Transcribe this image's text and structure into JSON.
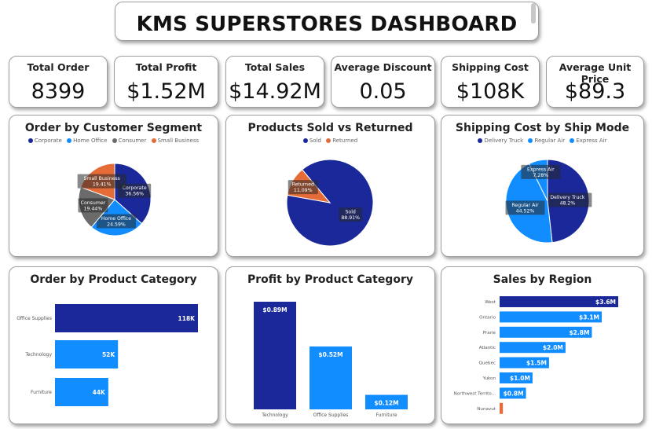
{
  "dashboard": {
    "title": "KMS SUPERSTORES DASHBOARD"
  },
  "kpis": [
    {
      "label": "Total Order",
      "value": "8399"
    },
    {
      "label": "Total Profit",
      "value": "$1.52M"
    },
    {
      "label": "Total Sales",
      "value": "$14.92M"
    },
    {
      "label": "Average Discount",
      "value": "0.05"
    },
    {
      "label": "Shipping Cost",
      "value": "$108K"
    },
    {
      "label": "Average Unit Price",
      "value": "$89.3"
    }
  ],
  "colors": {
    "dark_blue": "#1a2899",
    "light_blue": "#118dff",
    "orange": "#e66c37",
    "gray": "#6b6b6b"
  },
  "chart_data": [
    {
      "type": "pie",
      "title": "Order by Customer Segment",
      "legend": [
        "Corporate",
        "Home Office",
        "Consumer",
        "Small Business"
      ],
      "slices": [
        {
          "name": "Corporate",
          "value": 36.56,
          "label": "36.56%",
          "color": "#1a2899"
        },
        {
          "name": "Home Office",
          "value": 24.59,
          "label": "24.59%",
          "color": "#118dff"
        },
        {
          "name": "Consumer",
          "value": 19.44,
          "label": "19.44%",
          "color": "#6b6b6b"
        },
        {
          "name": "Small Business",
          "value": 19.41,
          "label": "19.41%",
          "color": "#e66c37"
        }
      ]
    },
    {
      "type": "pie",
      "title": "Products Sold vs Returned",
      "legend": [
        "Sold",
        "Returned"
      ],
      "slices": [
        {
          "name": "Sold",
          "value": 88.91,
          "label": "88.91%",
          "color": "#1a2899"
        },
        {
          "name": "Returned",
          "value": 11.09,
          "label": "11.09%",
          "color": "#e66c37"
        }
      ]
    },
    {
      "type": "pie",
      "title": "Shipping Cost by Ship Mode",
      "legend": [
        "Delivery Truck",
        "Regular Air",
        "Express Air"
      ],
      "slices": [
        {
          "name": "Delivery Truck",
          "value": 48.2,
          "label": "48.2%",
          "color": "#1a2899"
        },
        {
          "name": "Regular Air",
          "value": 44.52,
          "label": "44.52%",
          "color": "#118dff"
        },
        {
          "name": "Express Air",
          "value": 7.28,
          "label": "7.28%",
          "color": "#118dff"
        }
      ]
    },
    {
      "type": "bar",
      "orientation": "horizontal",
      "title": "Order by Product Category",
      "categories": [
        "Office Supplies",
        "Technology",
        "Furniture"
      ],
      "values": [
        118,
        52,
        44
      ],
      "data_labels": [
        "118K",
        "52K",
        "44K"
      ],
      "colors": [
        "#1a2899",
        "#118dff",
        "#118dff"
      ]
    },
    {
      "type": "bar",
      "orientation": "vertical",
      "title": "Profit by Product Category",
      "categories": [
        "Technology",
        "Office Supplies",
        "Furniture"
      ],
      "values": [
        0.89,
        0.52,
        0.12
      ],
      "data_labels": [
        "$0.89M",
        "$0.52M",
        "$0.12M"
      ],
      "colors": [
        "#1a2899",
        "#118dff",
        "#118dff"
      ]
    },
    {
      "type": "bar",
      "orientation": "horizontal",
      "title": "Sales by Region",
      "categories": [
        "West",
        "Ontario",
        "Prarie",
        "Atlantic",
        "Quebec",
        "Yukon",
        "Northwest Territo...",
        "Nunavut"
      ],
      "values": [
        3.6,
        3.1,
        2.8,
        2.0,
        1.5,
        1.0,
        0.8,
        0.1
      ],
      "data_labels": [
        "$3.6M",
        "$3.1M",
        "$2.8M",
        "$2.0M",
        "$1.5M",
        "$1.0M",
        "$0.8M",
        ""
      ],
      "colors": [
        "#1a2899",
        "#118dff",
        "#118dff",
        "#118dff",
        "#118dff",
        "#118dff",
        "#118dff",
        "#e66c37"
      ]
    }
  ]
}
